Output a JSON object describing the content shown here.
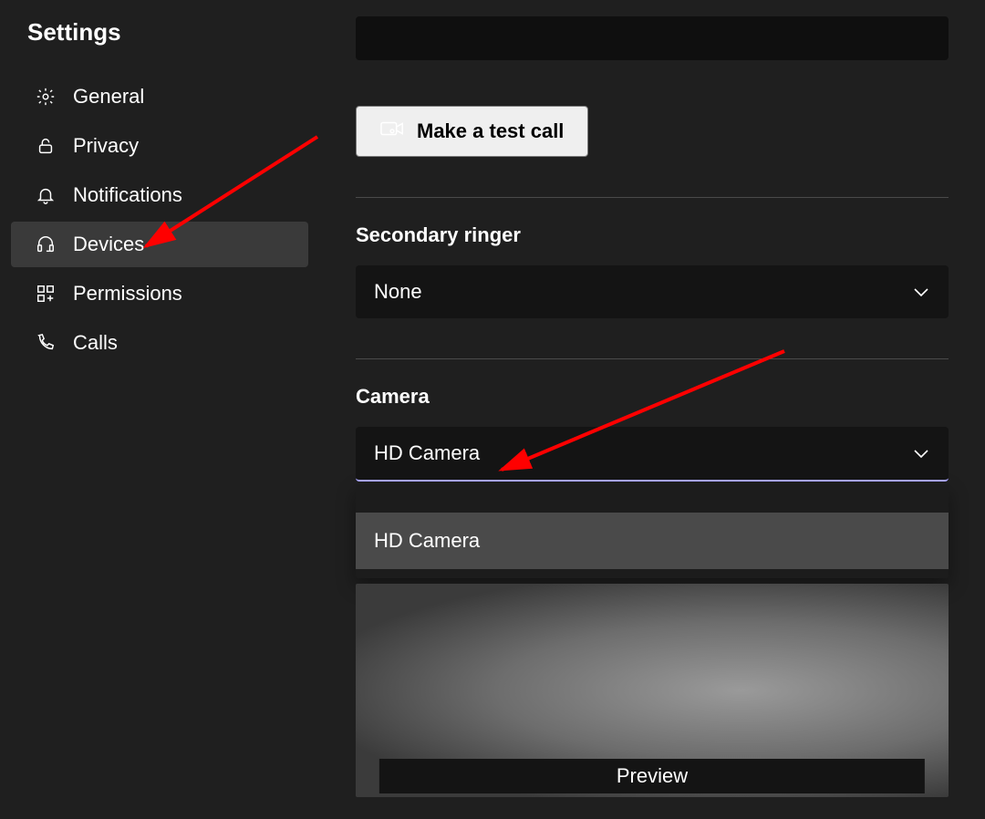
{
  "title": "Settings",
  "sidebar": {
    "items": [
      {
        "label": "General",
        "icon": "gear-icon",
        "active": false
      },
      {
        "label": "Privacy",
        "icon": "lock-icon",
        "active": false
      },
      {
        "label": "Notifications",
        "icon": "bell-icon",
        "active": false
      },
      {
        "label": "Devices",
        "icon": "headset-icon",
        "active": true
      },
      {
        "label": "Permissions",
        "icon": "apps-icon",
        "active": false
      },
      {
        "label": "Calls",
        "icon": "phone-icon",
        "active": false
      }
    ]
  },
  "main": {
    "test_call_button": "Make a test call",
    "secondary_ringer": {
      "label": "Secondary ringer",
      "value": "None"
    },
    "camera": {
      "label": "Camera",
      "value": "HD Camera",
      "options": [
        "HD Camera"
      ],
      "preview_label": "Preview"
    }
  }
}
